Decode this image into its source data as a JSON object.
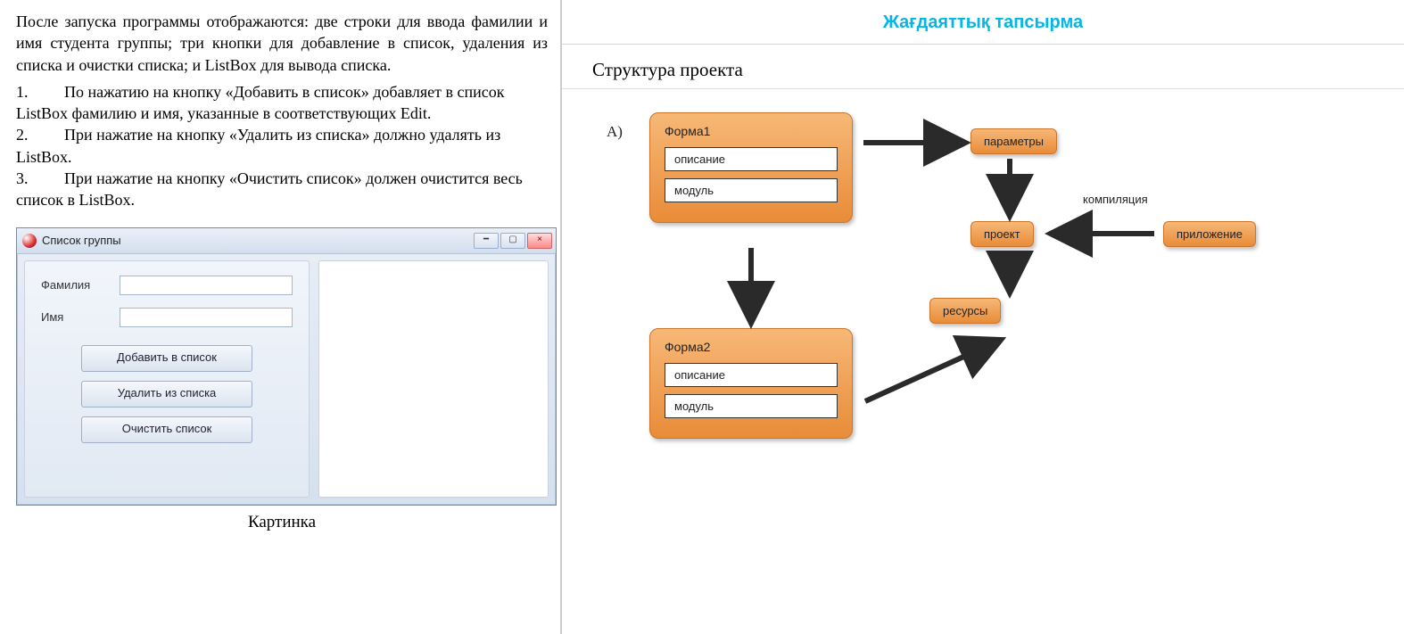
{
  "left": {
    "intro": "После запуска программы отображаются: две строки для ввода фамилии и имя студента группы; три кнопки для добавление в список, удаления из списка и очистки списка;  и ListBox для вывода списка.",
    "points": [
      "По нажатию на кнопку «Добавить в список» добавляет в список ListBox фамилию и имя, указанные в соответствующих Edit.",
      "При нажатие на кнопку «Удалить из списка» должно удалять из ListBox.",
      "При нажатие на кнопку «Очистить список» должен очистится весь список в ListBox."
    ],
    "caption": "Картинка",
    "app": {
      "title": "Список группы",
      "label_surname": "Фамилия",
      "label_name": "Имя",
      "btn_add": "Добавить в список",
      "btn_del": "Удалить из списка",
      "btn_clear": "Очистить список"
    }
  },
  "right": {
    "title": "Жағдаяттық тапсырма",
    "subtitle": "Структура проекта",
    "option_letter": "A)",
    "diagram": {
      "form1": {
        "title": "Форма1",
        "desc": "описание",
        "module": "модуль"
      },
      "form2": {
        "title": "Форма2",
        "desc": "описание",
        "module": "модуль"
      },
      "params": "параметры",
      "project": "проект",
      "resources": "ресурсы",
      "app": "приложение",
      "compile_label": "компиляция"
    }
  }
}
